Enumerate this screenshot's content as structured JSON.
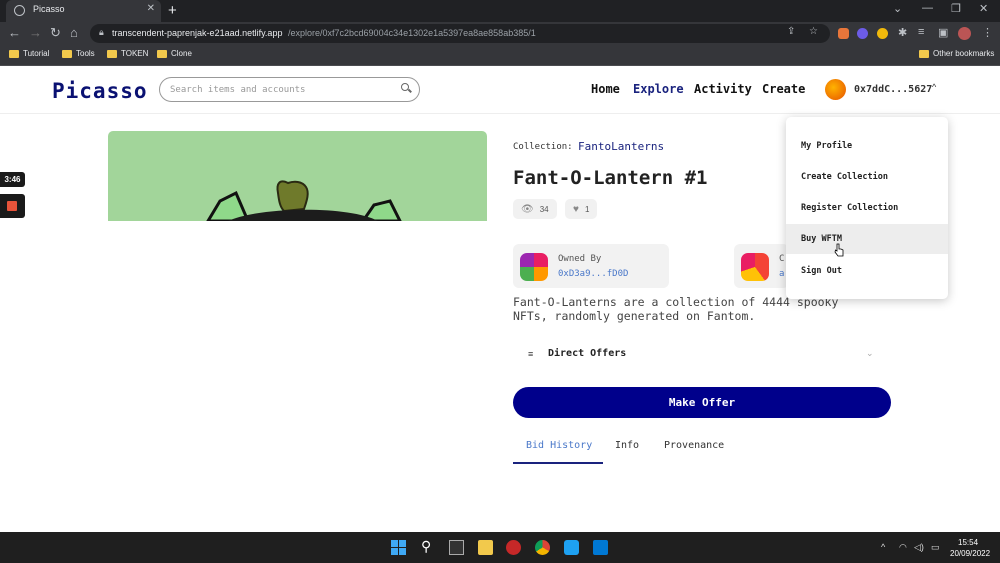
{
  "browser": {
    "tab_title": "Picasso",
    "url_host": "transcendent-paprenjak-e21aad.netlify.app",
    "url_path": "/explore/0xf7c2bcd69004c34e1302e1a5397ea8ae858ab385/1",
    "bookmarks": [
      "Tutorial",
      "Tools",
      "TOKEN",
      "Clone"
    ],
    "other_bookmarks": "Other bookmarks"
  },
  "header": {
    "logo": "Picasso",
    "search_placeholder": "Search items and accounts",
    "nav": [
      "Home",
      "Explore",
      "Activity",
      "Create"
    ],
    "address": "0x7ddC...5627",
    "caret": "^"
  },
  "recording": {
    "time": "3:46"
  },
  "nft": {
    "collection_label": "Collection:",
    "collection_name": "FantoLanterns",
    "title": "Fant-O-Lantern #1",
    "views": "34",
    "likes": "1",
    "owner_label": "Owned By",
    "owner_address": "0xD3a9...fD0D",
    "creator_label": "C",
    "creator_address": "a",
    "description": "Fant-O-Lanterns are a collection of 4444 spooky NFTs, randomly generated on Fantom.",
    "offers_label": "Direct Offers",
    "make_offer": "Make Offer",
    "tabs": [
      "Bid History",
      "Info",
      "Provenance"
    ]
  },
  "dropdown": {
    "items": [
      "My Profile",
      "Create Collection",
      "Register Collection",
      "Buy WFTM",
      "Sign Out"
    ],
    "hovered": "Buy WFTM"
  },
  "taskbar": {
    "time": "15:54",
    "date": "20/09/2022"
  }
}
